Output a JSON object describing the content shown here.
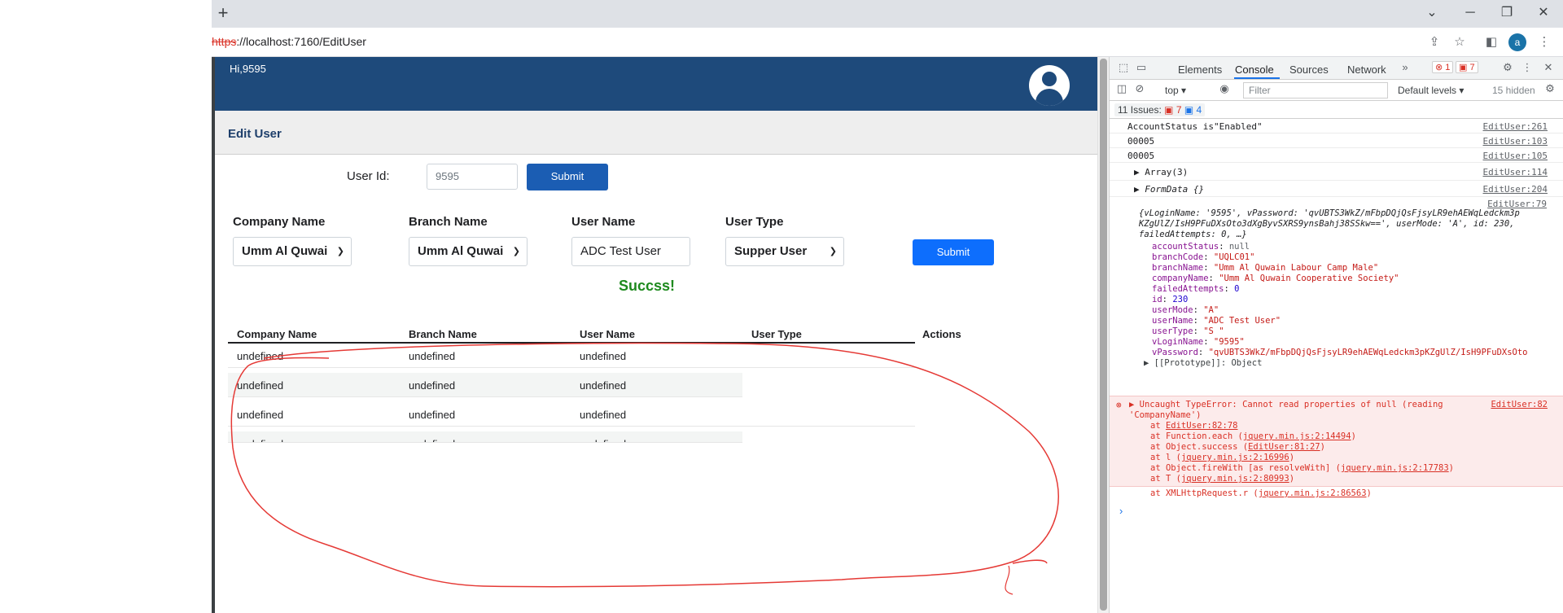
{
  "browser": {
    "new_tab": "+",
    "url_scheme": "https",
    "url_rest": "://localhost:7160/EditUser",
    "profile_initial": "a"
  },
  "app": {
    "greeting": "Hi,9595",
    "page_title": "Edit User",
    "user_id_label": "User Id:",
    "user_id_value": "9595",
    "submit_top": "Submit",
    "company_label": "Company Name",
    "branch_label": "Branch Name",
    "username_label": "User Name",
    "usertype_label": "User Type",
    "company_value": "Umm Al Quwai",
    "branch_value": "Umm Al Quwai",
    "username_value": "ADC Test User",
    "usertype_value": "Supper User",
    "submit_form": "Submit",
    "success": "Succss!",
    "table": {
      "headers": [
        "Company Name",
        "Branch Name",
        "User Name",
        "User Type",
        "Actions"
      ],
      "rows": [
        [
          "undefined",
          "undefined",
          "undefined"
        ],
        [
          "undefined",
          "undefined",
          "undefined"
        ],
        [
          "undefined",
          "undefined",
          "undefined"
        ],
        [
          "undefined",
          "undefined",
          "undefined"
        ]
      ]
    }
  },
  "devtools": {
    "tabs": [
      "Elements",
      "Console",
      "Sources",
      "Network"
    ],
    "err_count": "1",
    "warn_count": "7",
    "context": "top",
    "filter_placeholder": "Filter",
    "levels": "Default levels",
    "hidden": "15 hidden",
    "issues": "11 Issues:",
    "issues_err": "7",
    "issues_info": "4",
    "logs": [
      {
        "msg": "AccountStatus is\"Enabled\"",
        "src": "EditUser:261"
      },
      {
        "msg": "00005",
        "src": "EditUser:103"
      },
      {
        "msg": "00005",
        "src": "EditUser:105"
      },
      {
        "msg": "▶ Array(3)",
        "src": "EditUser:114"
      },
      {
        "msg": "▶ FormData {}",
        "src": "EditUser:204"
      }
    ],
    "obj_src": "EditUser:79",
    "obj_preview_1": "{vLoginName: '9595', vPassword: 'qvUBTS3WkZ/mFbpDQjQsFjsyLR9ehAEWqLedckm3p",
    "obj_preview_2": "KZgUlZ/IsH9PFuDXsOto3dXgByvSXRS9ynsBahj38SSkw==', userMode: 'A', id: 230,",
    "obj_preview_3": "failedAttempts: 0, …}",
    "obj_props": [
      {
        "k": "accountStatus",
        "v": "null",
        "t": "g"
      },
      {
        "k": "branchCode",
        "v": "\"UQLC01\"",
        "t": "s"
      },
      {
        "k": "branchName",
        "v": "\"Umm Al Quwain Labour Camp Male\"",
        "t": "s"
      },
      {
        "k": "companyName",
        "v": "\"Umm Al Quwain Cooperative Society\"",
        "t": "s"
      },
      {
        "k": "failedAttempts",
        "v": "0",
        "t": "n"
      },
      {
        "k": "id",
        "v": "230",
        "t": "n"
      },
      {
        "k": "userMode",
        "v": "\"A\"",
        "t": "s"
      },
      {
        "k": "userName",
        "v": "\"ADC Test User\"",
        "t": "s"
      },
      {
        "k": "userType",
        "v": "\"S \"",
        "t": "s"
      },
      {
        "k": "vLoginName",
        "v": "\"9595\"",
        "t": "s"
      },
      {
        "k": "vPassword",
        "v": "\"qvUBTS3WkZ/mFbpDQjQsFjsyLR9ehAEWqLedckm3pKZgUlZ/IsH9PFuDXsOto",
        "t": "s"
      }
    ],
    "prototype": "▶ [[Prototype]]: Object",
    "error_title_1": "▶ Uncaught TypeError: Cannot read properties of null (reading",
    "error_title_2": "'CompanyName')",
    "error_src": "EditUser:82",
    "stack": [
      {
        "pre": "at ",
        "fn": "",
        "link": "EditUser:82:78"
      },
      {
        "pre": "at Function.each (",
        "fn": "",
        "link": "jquery.min.js:2:14494",
        "post": ")"
      },
      {
        "pre": "at Object.success (",
        "fn": "",
        "link": "EditUser:81:27",
        "post": ")"
      },
      {
        "pre": "at l (",
        "fn": "",
        "link": "jquery.min.js:2:16996",
        "post": ")"
      },
      {
        "pre": "at Object.fireWith [as resolveWith] (",
        "fn": "",
        "link": "jquery.min.js:2:17783",
        "post": ")"
      },
      {
        "pre": "at T (",
        "fn": "",
        "link": "jquery.min.js:2:80993",
        "post": ")"
      },
      {
        "pre": "at XMLHttpRequest.r (",
        "fn": "",
        "link": "jquery.min.js:2:86563",
        "post": ")"
      }
    ],
    "prompt": "›"
  }
}
